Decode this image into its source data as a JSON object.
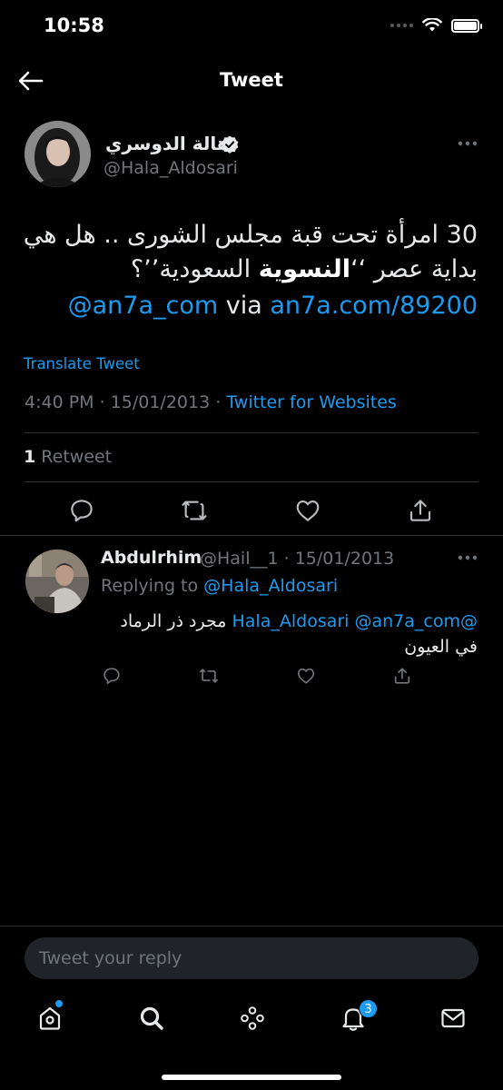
{
  "status_bar": {
    "time": "10:58"
  },
  "header": {
    "title": "Tweet"
  },
  "tweet": {
    "author_name": "هالة الدوسري",
    "handle": "@Hala_Aldosari",
    "text_line1": "30 امرأة تحت قبة مجلس الشورى .. هل هي",
    "text_line2_pre": "بداية عصر ‘‘",
    "text_line2_bold": "النسوية",
    "text_line2_post": " السعودية’’؟",
    "mention": "@an7a_com",
    "via": "via",
    "link": "an7a.com/89200",
    "translate_label": "Translate Tweet",
    "timestamp": "4:40 PM · 15/01/2013 · ",
    "source": "Twitter for Websites",
    "retweet_count": "1",
    "retweet_label": "Retweet"
  },
  "reply": {
    "author_name": "Abdulrhim",
    "handle_date": "@Hail__1 · 15/01/2013",
    "replying_to_label": "Replying to ",
    "replying_to_handle": "@Hala_Aldosari",
    "text_ar": "مجرد ذر الرماد في العيون",
    "mention_1": "@Hala_Aldosari",
    "mention_2": "@an7a_com"
  },
  "reply_box": {
    "placeholder": "Tweet your reply"
  },
  "tab_bar": {
    "notifications_badge": "3"
  },
  "colors": {
    "accent": "#1d9bf0",
    "background": "#000000",
    "secondary_text": "#71767b"
  }
}
